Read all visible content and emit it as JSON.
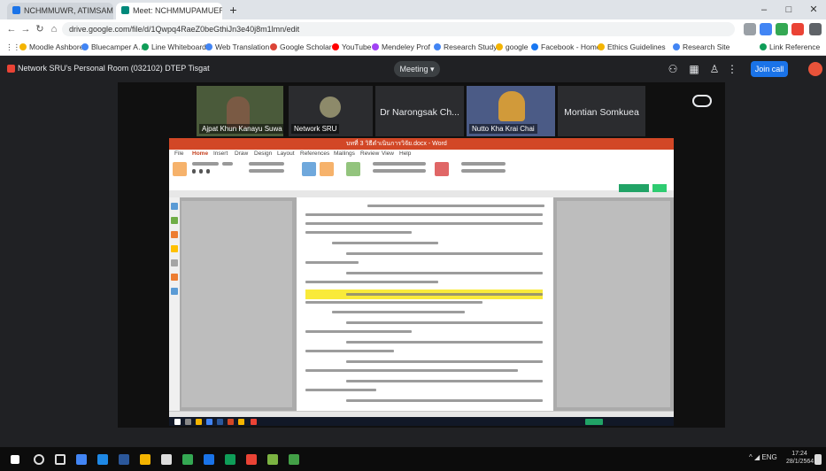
{
  "browser": {
    "tabs": [
      {
        "label": "NCHMMUWR, ATIMSAMMUN",
        "active": false
      },
      {
        "label": "Meet: NCHMMUPAMUER",
        "active": true
      }
    ],
    "new_tab": "+",
    "url": "drive.google.com/file/d/1Qwpq4RaeZ0beGthiJn3e40j8m1lmn/edit",
    "window_controls": [
      "–",
      "□",
      "✕"
    ],
    "bookmarks": [
      {
        "label": "Moodle Ashbore",
        "color": "#f4b400"
      },
      {
        "label": "Bluecamper A…",
        "color": "#4285f4"
      },
      {
        "label": "Line Whiteboard",
        "color": "#0f9d58"
      },
      {
        "label": "Web Translation",
        "color": "#4285f4"
      },
      {
        "label": "Google Scholar",
        "color": "#db4437"
      },
      {
        "label": "YouTube",
        "color": "#ff0000"
      },
      {
        "label": "Mendeley Prof",
        "color": "#a142f4"
      },
      {
        "label": "Research Study",
        "color": "#4285f4"
      },
      {
        "label": "google",
        "color": "#f4b400"
      },
      {
        "label": "Facebook - Home",
        "color": "#1877f2"
      },
      {
        "label": "Ethics Guidelines",
        "color": "#f4b400"
      },
      {
        "label": "Research Site",
        "color": "#4285f4"
      },
      {
        "label": "Link Reference",
        "color": "#0f9d58"
      }
    ]
  },
  "meet": {
    "title": "Network SRU's Personal Room (032102) DTEP Tisgat",
    "presenting_label": "Meeting",
    "join_label": "Join call",
    "participants": [
      {
        "name": "Ajpat Khun Kanayu Suwa"
      },
      {
        "name": "Network SRU"
      },
      {
        "name": "Dr Narongsak Ch..."
      },
      {
        "name": "Nutto Kha Krai Chai"
      },
      {
        "name": "Montian Somkuea"
      }
    ]
  },
  "word": {
    "title": "บทที่ 3 วิธีดำเนินการวิจัย.docx - Word",
    "ribbon_tabs": [
      "File",
      "Home",
      "Insert",
      "Draw",
      "Design",
      "Layout",
      "References",
      "Mailings",
      "Review",
      "View",
      "Help"
    ]
  },
  "taskbar": {
    "tray_text": "ENG",
    "clock_time": "17:24",
    "clock_date": "28/1/2564"
  }
}
